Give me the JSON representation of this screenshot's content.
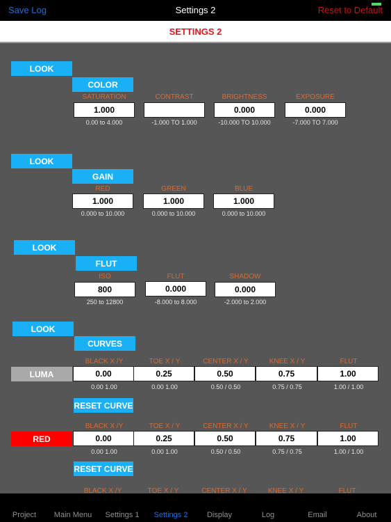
{
  "topbar": {
    "left_button": "Save Log",
    "title": "Settings 2",
    "right_button": "Reset to Default"
  },
  "header": {
    "title": "SETTINGS 2"
  },
  "sections": {
    "color": {
      "group_label": "LOOK",
      "section_label": "COLOR",
      "fields": [
        {
          "label": "SATURATION",
          "value": "1.000",
          "range": "0.00 to 4.000"
        },
        {
          "label": "CONTRAST",
          "value": "",
          "range": "-1.000 TO 1.000"
        },
        {
          "label": "BRIGHTNESS",
          "value": "0.000",
          "range": "-10.000 TO 10.000"
        },
        {
          "label": "EXPOSURE",
          "value": "0.000",
          "range": "-7.000 TO 7.000"
        }
      ]
    },
    "gain": {
      "group_label": "LOOK",
      "section_label": "GAIN",
      "fields": [
        {
          "label": "RED",
          "value": "1.000",
          "range": "0.000 to 10.000"
        },
        {
          "label": "GREEN",
          "value": "1.000",
          "range": "0.000 to 10.000"
        },
        {
          "label": "BLUE",
          "value": "1.000",
          "range": "0.000 to 10.000"
        }
      ]
    },
    "flut": {
      "group_label": "LOOK",
      "section_label": "FLUT",
      "fields": [
        {
          "label": "ISO",
          "value": "800",
          "range": "250 to 12800"
        },
        {
          "label": "FLUT",
          "value": "0.000",
          "range": "-8.000 to 8.000"
        },
        {
          "label": "SHADOW",
          "value": "0.000",
          "range": "-2.000 to 2.000"
        }
      ]
    },
    "curves": {
      "group_label": "LOOK",
      "section_label": "CURVES",
      "reset_label": "RESET CURVE",
      "columns": [
        "BLACK X /Y",
        "TOE X / Y",
        "CENTER X / Y",
        "KNEE X / Y",
        "FLUT"
      ],
      "rows": [
        {
          "name": "LUMA",
          "color": "#a9a9a9",
          "values": [
            "0.00",
            "0.25",
            "0.50",
            "0.75",
            "1.00"
          ],
          "ranges": [
            "0.00 1.00",
            "0.00  1.00",
            "0.50 / 0.50",
            "0.75 / 0.75",
            "1.00 / 1.00"
          ]
        },
        {
          "name": "RED",
          "color": "#ff0000",
          "values": [
            "0.00",
            "0.25",
            "0.50",
            "0.75",
            "1.00"
          ],
          "ranges": [
            "0.00 1.00",
            "0.00  1.00",
            "0.50 / 0.50",
            "0.75 / 0.75",
            "1.00 / 1.00"
          ]
        }
      ]
    }
  },
  "tabs": [
    {
      "label": "Project",
      "active": false
    },
    {
      "label": "Main Menu",
      "active": false
    },
    {
      "label": "Settings 1",
      "active": false
    },
    {
      "label": "Settings 2",
      "active": true
    },
    {
      "label": "Display",
      "active": false
    },
    {
      "label": "Log",
      "active": false
    },
    {
      "label": "Email",
      "active": false
    },
    {
      "label": "About",
      "active": false
    }
  ],
  "colors": {
    "accent_blue": "#1ab0f5",
    "label_orange": "#e0692a",
    "title_red": "#e8151c",
    "active_tab": "#1e6fd9"
  }
}
